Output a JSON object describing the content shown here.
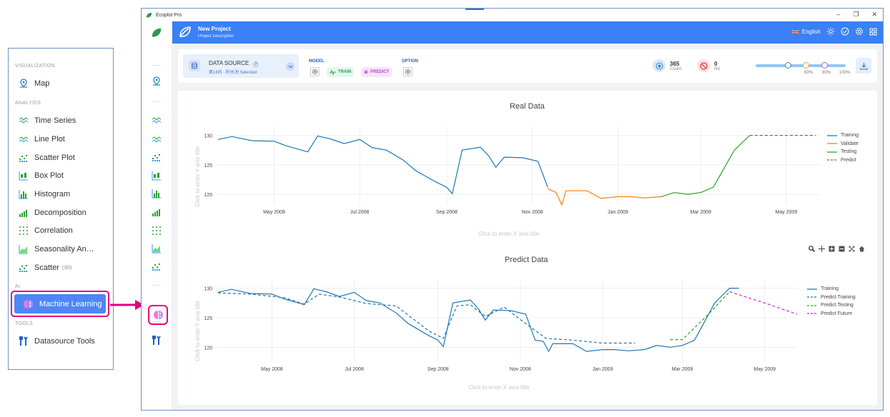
{
  "sidebar": {
    "sections": {
      "visualization": "VISUALIZATION",
      "analysis": "ANALYSIS",
      "ai": "AI",
      "tools": "TOOLS"
    },
    "items": {
      "map": "Map",
      "time_series": "Time Series",
      "line_plot": "Line Plot",
      "scatter_plot": "Scatter Plot",
      "box_plot": "Box Plot",
      "histogram": "Histogram",
      "decomposition": "Decomposition",
      "correlation": "Correlation",
      "seasonality": "Seasonality An…",
      "scatter": "Scatter",
      "scatter_sub": "(3D)",
      "machine_learning": "Machine Learning",
      "datasource_tools": "Datasource Tools"
    }
  },
  "window": {
    "title": "Ecoplot Pro"
  },
  "header": {
    "project_title": "New Project",
    "project_desc": "Project Description",
    "language": "English"
  },
  "toolbar": {
    "datasource_label": "DATA SOURCE",
    "datasource_help": "?",
    "datasource_selected": "第18内 - 貯水池 Selected",
    "model_label": "MODEL",
    "train_label": "TRAIN",
    "predict_label": "PREDICT",
    "option_label": "OPTION",
    "count_value": "365",
    "count_label": "Count",
    "na_value": "0",
    "na_label": "NA",
    "slider": {
      "train_pct": 0.6,
      "validate_pct": 0.8,
      "test_pct": 1.0,
      "labels": [
        "60%",
        "80%",
        "100%"
      ]
    }
  },
  "colors": {
    "accent": "#3a80f6",
    "training": "#1f77b4",
    "validate": "#ff7f0e",
    "testing": "#2ca02c",
    "predict": "#c030c0",
    "highlight": "#e6007e"
  },
  "chart_data": [
    {
      "type": "line",
      "title": "Real Data",
      "xlabel": "Click to enter X axis title",
      "ylabel": "Click to enter Y axis title",
      "xticks": [
        "May 2008",
        "Jul 2008",
        "Sep 2008",
        "Nov 2008",
        "Jan 2009",
        "Mar 2009",
        "May 2009"
      ],
      "yticks": [
        120,
        125,
        130
      ],
      "xlim": [
        "2008-03-21",
        "2009-05-25"
      ],
      "ylim": [
        118.2,
        131.4
      ],
      "legend": "top-right",
      "series": [
        {
          "name": "Training",
          "x": [
            "2008-03-22",
            "2008-04-01",
            "2008-04-15",
            "2008-05-01",
            "2008-05-10",
            "2008-05-25",
            "2008-06-01",
            "2008-06-10",
            "2008-06-20",
            "2008-07-01",
            "2008-07-10",
            "2008-07-20",
            "2008-08-01",
            "2008-08-10",
            "2008-08-25",
            "2008-09-01",
            "2008-09-05",
            "2008-09-12",
            "2008-09-25",
            "2008-10-01",
            "2008-10-06",
            "2008-10-12",
            "2008-10-25",
            "2008-11-05",
            "2008-11-12"
          ],
          "y": [
            129.3,
            129.8,
            129.1,
            129.0,
            128.2,
            127.2,
            129.9,
            129.4,
            128.6,
            129.3,
            127.9,
            127.5,
            125.8,
            124.0,
            122.0,
            121.2,
            120.1,
            127.5,
            128.0,
            126.5,
            124.6,
            126.3,
            126.2,
            125.6,
            121.2
          ]
        },
        {
          "name": "Validate",
          "x": [
            "2008-11-12",
            "2008-11-18",
            "2008-11-22",
            "2008-11-25",
            "2008-12-10",
            "2008-12-20",
            "2009-01-01",
            "2009-01-10",
            "2009-01-20",
            "2009-02-01"
          ],
          "y": [
            121.0,
            120.3,
            118.2,
            120.6,
            120.6,
            119.3,
            119.6,
            119.6,
            119.4,
            119.6
          ]
        },
        {
          "name": "Testing",
          "x": [
            "2009-02-01",
            "2009-02-10",
            "2009-02-20",
            "2009-03-01",
            "2009-03-10",
            "2009-03-25",
            "2009-04-05"
          ],
          "y": [
            119.6,
            120.3,
            120.0,
            120.3,
            121.2,
            127.5,
            130.0
          ]
        },
        {
          "name": "Predict",
          "dash": true,
          "x": [
            "2009-04-05",
            "2009-05-22"
          ],
          "y": [
            130.0,
            130.0
          ]
        }
      ]
    },
    {
      "type": "line",
      "title": "Predict Data",
      "xlabel": "Click to enter X axis title",
      "ylabel": "Click to enter Y axis title",
      "xticks": [
        "May 2008",
        "Jul 2008",
        "Sep 2008",
        "Nov 2008",
        "Jan 2009",
        "Mar 2009",
        "May 2009"
      ],
      "yticks": [
        120,
        125,
        130
      ],
      "xlim": [
        "2008-03-21",
        "2009-05-25"
      ],
      "ylim": [
        117.5,
        131.4
      ],
      "legend": "top-right",
      "series": [
        {
          "name": "Training",
          "x": [
            "2008-03-22",
            "2008-04-01",
            "2008-04-15",
            "2008-05-01",
            "2008-05-10",
            "2008-05-25",
            "2008-06-01",
            "2008-06-10",
            "2008-06-20",
            "2008-07-01",
            "2008-07-10",
            "2008-07-20",
            "2008-08-01",
            "2008-08-10",
            "2008-08-25",
            "2008-09-01",
            "2008-09-05",
            "2008-09-12",
            "2008-09-25",
            "2008-10-01",
            "2008-10-06",
            "2008-10-12",
            "2008-10-25",
            "2008-11-05",
            "2008-11-12",
            "2008-11-18",
            "2008-11-22",
            "2008-11-25",
            "2008-12-10",
            "2008-12-20",
            "2009-01-01",
            "2009-01-10",
            "2009-01-20",
            "2009-02-01",
            "2009-02-10",
            "2009-02-20",
            "2009-03-01",
            "2009-03-10",
            "2009-03-25",
            "2009-04-05",
            "2009-04-12"
          ],
          "y": [
            129.3,
            129.8,
            129.1,
            129.0,
            128.2,
            127.2,
            129.9,
            129.4,
            128.6,
            129.3,
            127.9,
            127.5,
            125.8,
            124.0,
            122.0,
            121.2,
            120.1,
            127.5,
            128.0,
            126.5,
            124.6,
            126.3,
            126.2,
            125.6,
            121.2,
            121.0,
            119.3,
            120.6,
            120.6,
            119.3,
            119.6,
            119.6,
            119.4,
            119.6,
            120.3,
            120.0,
            120.3,
            121.2,
            127.5,
            130.0,
            130.0
          ]
        },
        {
          "name": "Predict Training",
          "dash": true,
          "x": [
            "2008-03-22",
            "2008-04-15",
            "2008-05-10",
            "2008-05-25",
            "2008-06-05",
            "2008-06-20",
            "2008-07-10",
            "2008-08-01",
            "2008-08-25",
            "2008-09-05",
            "2008-09-15",
            "2008-09-25",
            "2008-10-06",
            "2008-10-20",
            "2008-11-05",
            "2008-11-20",
            "2008-12-10",
            "2009-01-01",
            "2009-01-25"
          ],
          "y": [
            129.2,
            129.0,
            128.4,
            127.3,
            129.0,
            128.5,
            127.4,
            127.0,
            122.8,
            121.5,
            127.0,
            127.2,
            125.2,
            126.8,
            124.0,
            121.5,
            121.2,
            120.7,
            120.7
          ]
        },
        {
          "name": "Predict Testing",
          "dash": true,
          "x": [
            "2009-02-20",
            "2009-03-01",
            "2009-03-20",
            "2009-04-05"
          ],
          "y": [
            121.3,
            121.3,
            125.5,
            129.4
          ]
        },
        {
          "name": "Predict Future",
          "dash": true,
          "x": [
            "2009-04-05",
            "2009-05-01",
            "2009-05-25"
          ],
          "y": [
            129.4,
            127.5,
            125.6
          ]
        }
      ]
    }
  ]
}
